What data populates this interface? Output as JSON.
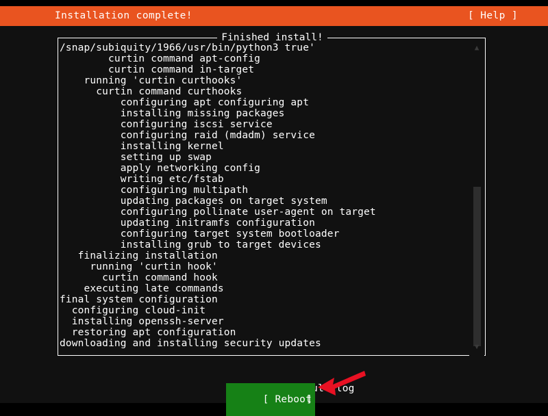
{
  "header": {
    "title": "Installation complete!",
    "help_label": "[ Help ]"
  },
  "log_panel": {
    "frame_title": "Finished install!",
    "lines": [
      "/snap/subiquity/1966/usr/bin/python3 true'",
      "        curtin command apt-config",
      "        curtin command in-target",
      "    running 'curtin curthooks'",
      "      curtin command curthooks",
      "          configuring apt configuring apt",
      "          installing missing packages",
      "          configuring iscsi service",
      "          configuring raid (mdadm) service",
      "          installing kernel",
      "          setting up swap",
      "          apply networking config",
      "          writing etc/fstab",
      "          configuring multipath",
      "          updating packages on target system",
      "          configuring pollinate user-agent on target",
      "          updating initramfs configuration",
      "          configuring target system bootloader",
      "          installing grub to target devices",
      "   finalizing installation",
      "     running 'curtin hook'",
      "       curtin command hook",
      "    executing late commands",
      "final system configuration",
      "  configuring cloud-init",
      "  installing openssh-server",
      "  restoring apt configuration",
      "downloading and installing security updates"
    ]
  },
  "scrollbar": {
    "up_arrow_glyph": "▲",
    "down_arrow_glyph": "▼"
  },
  "buttons": {
    "view_full_log": {
      "bracket_left": "[",
      "label": " View full log ",
      "bracket_right": "]"
    },
    "reboot": {
      "bracket_left": "[",
      "label": " Reboot",
      "bracket_right": "]"
    }
  },
  "colors": {
    "ubuntu_orange": "#e95420",
    "selection_green": "#168116",
    "terminal_bg": "#111111",
    "text_white": "#ffffff",
    "annotation_red": "#e81123",
    "scrollbar_thumb": "#2e2e2e"
  },
  "annotation": {
    "arrow_name": "red-pointer-arrow",
    "points_to": "reboot"
  }
}
